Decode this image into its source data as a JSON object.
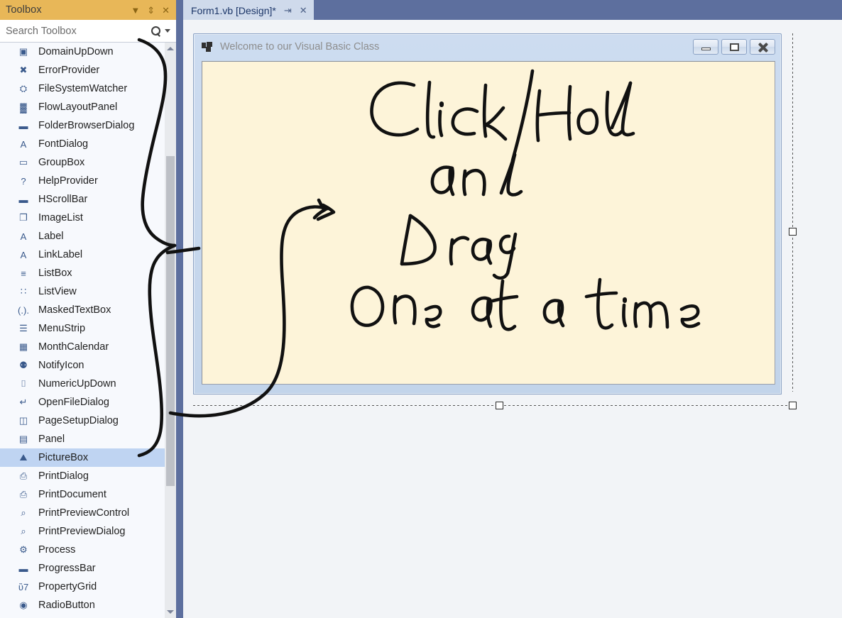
{
  "toolbox": {
    "title": "Toolbox",
    "header_icons": [
      {
        "name": "chevron-down-icon",
        "glyph": "▼"
      },
      {
        "name": "pin-icon",
        "glyph": "⇕"
      },
      {
        "name": "close-icon",
        "glyph": "✕"
      }
    ],
    "search": {
      "placeholder": "Search Toolbox",
      "value": "Search Toolbox",
      "icon": "search-icon",
      "dropdown_icon": "chevron-down-icon"
    },
    "selected_item": "PictureBox",
    "items": [
      {
        "label": "DomainUpDown",
        "icon": "domainupdown-icon",
        "glyph": "▣"
      },
      {
        "label": "ErrorProvider",
        "icon": "errorprovider-icon",
        "glyph": "✖"
      },
      {
        "label": "FileSystemWatcher",
        "icon": "filesystemwatcher-icon",
        "glyph": "⛭"
      },
      {
        "label": "FlowLayoutPanel",
        "icon": "flowlayoutpanel-icon",
        "glyph": "▓"
      },
      {
        "label": "FolderBrowserDialog",
        "icon": "folderbrowserdialog-icon",
        "glyph": "▬"
      },
      {
        "label": "FontDialog",
        "icon": "fontdialog-icon",
        "glyph": "A"
      },
      {
        "label": "GroupBox",
        "icon": "groupbox-icon",
        "glyph": "▭"
      },
      {
        "label": "HelpProvider",
        "icon": "helpprovider-icon",
        "glyph": "?"
      },
      {
        "label": "HScrollBar",
        "icon": "hscrollbar-icon",
        "glyph": "▬"
      },
      {
        "label": "ImageList",
        "icon": "imagelist-icon",
        "glyph": "❐"
      },
      {
        "label": "Label",
        "icon": "label-icon",
        "glyph": "A"
      },
      {
        "label": "LinkLabel",
        "icon": "linklabel-icon",
        "glyph": "A"
      },
      {
        "label": "ListBox",
        "icon": "listbox-icon",
        "glyph": "≡"
      },
      {
        "label": "ListView",
        "icon": "listview-icon",
        "glyph": "∷"
      },
      {
        "label": "MaskedTextBox",
        "icon": "maskedtextbox-icon",
        "glyph": "(.)."
      },
      {
        "label": "MenuStrip",
        "icon": "menustrip-icon",
        "glyph": "☰"
      },
      {
        "label": "MonthCalendar",
        "icon": "monthcalendar-icon",
        "glyph": "▦"
      },
      {
        "label": "NotifyIcon",
        "icon": "notifyicon-icon",
        "glyph": "⚉"
      },
      {
        "label": "NumericUpDown",
        "icon": "numericupdown-icon",
        "glyph": "⌷"
      },
      {
        "label": "OpenFileDialog",
        "icon": "openfiledialog-icon",
        "glyph": "↵"
      },
      {
        "label": "PageSetupDialog",
        "icon": "pagesetupdialog-icon",
        "glyph": "◫"
      },
      {
        "label": "Panel",
        "icon": "panel-icon",
        "glyph": "▤"
      },
      {
        "label": "PictureBox",
        "icon": "picturebox-icon",
        "glyph": "⛰"
      },
      {
        "label": "PrintDialog",
        "icon": "printdialog-icon",
        "glyph": "⎙"
      },
      {
        "label": "PrintDocument",
        "icon": "printdocument-icon",
        "glyph": "⎙"
      },
      {
        "label": "PrintPreviewControl",
        "icon": "printpreviewcontrol-icon",
        "glyph": "⌕"
      },
      {
        "label": "PrintPreviewDialog",
        "icon": "printpreviewdialog-icon",
        "glyph": "⌕"
      },
      {
        "label": "Process",
        "icon": "process-icon",
        "glyph": "⚙"
      },
      {
        "label": "ProgressBar",
        "icon": "progressbar-icon",
        "glyph": "▬"
      },
      {
        "label": "PropertyGrid",
        "icon": "propertygrid-icon",
        "glyph": "ὒ7"
      },
      {
        "label": "RadioButton",
        "icon": "radiobutton-icon",
        "glyph": "◉"
      }
    ],
    "scrollbar": {
      "up_icon": "scroll-up-arrow-icon",
      "down_icon": "scroll-down-arrow-icon"
    }
  },
  "editor": {
    "tab": {
      "label": "Form1.vb [Design]*",
      "pin_icon": "pin-icon",
      "pin_glyph": "⇥",
      "close_icon": "close-icon",
      "close_glyph": "✕"
    }
  },
  "form": {
    "title": "Welcome to our Visual Basic Class",
    "icon": "vb-form-icon",
    "buttons": [
      {
        "name": "minimize-button",
        "label": "Minimize"
      },
      {
        "name": "maximize-button",
        "label": "Maximize"
      },
      {
        "name": "close-button",
        "label": "Close"
      }
    ],
    "picturebox": {
      "name": "picturebox-control",
      "background_color": "#fdf4d9"
    }
  },
  "annotations": {
    "handwriting_lines": [
      "Click/Hold",
      "and",
      "Drag",
      "One at a time"
    ],
    "arrow_name": "ink-arrow-to-form",
    "brace_name": "ink-brace-toolbox",
    "ink_color": "#111111"
  },
  "colors": {
    "toolbox_header": "#e8b758",
    "tab_active": "#cfdaeb",
    "tabstrip": "#5d6f9e",
    "selection": "#bfd4f2",
    "form_chrome": "#c8d9ee",
    "picturebox": "#fdf4d9"
  }
}
